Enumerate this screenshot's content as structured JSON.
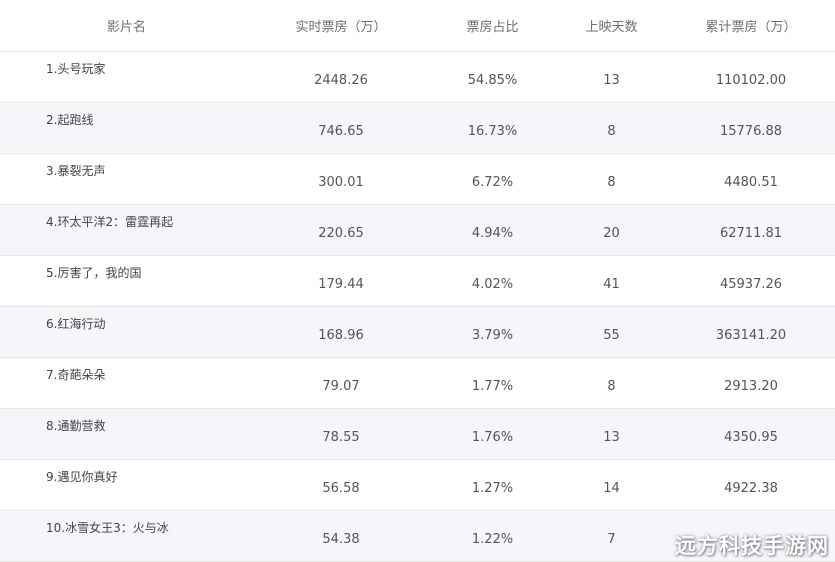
{
  "headers": [
    "影片名",
    "实时票房（万）",
    "票房占比",
    "上映天数",
    "累计票房（万）"
  ],
  "rows": [
    {
      "title": "1.头号玩家",
      "realtime": "2448.26",
      "share": "54.85%",
      "days": "13",
      "total": "110102.00"
    },
    {
      "title": "2.起跑线",
      "realtime": "746.65",
      "share": "16.73%",
      "days": "8",
      "total": "15776.88"
    },
    {
      "title": "3.暴裂无声",
      "realtime": "300.01",
      "share": "6.72%",
      "days": "8",
      "total": "4480.51"
    },
    {
      "title": "4.环太平洋2：雷霆再起",
      "realtime": "220.65",
      "share": "4.94%",
      "days": "20",
      "total": "62711.81"
    },
    {
      "title": "5.厉害了，我的国",
      "realtime": "179.44",
      "share": "4.02%",
      "days": "41",
      "total": "45937.26"
    },
    {
      "title": "6.红海行动",
      "realtime": "168.96",
      "share": "3.79%",
      "days": "55",
      "total": "363141.20"
    },
    {
      "title": "7.奇葩朵朵",
      "realtime": "79.07",
      "share": "1.77%",
      "days": "8",
      "total": "2913.20"
    },
    {
      "title": "8.通勤营救",
      "realtime": "78.55",
      "share": "1.76%",
      "days": "13",
      "total": "4350.95"
    },
    {
      "title": "9.遇见你真好",
      "realtime": "56.58",
      "share": "1.27%",
      "days": "14",
      "total": "4922.38"
    },
    {
      "title": "10.冰雪女王3：火与冰",
      "realtime": "54.38",
      "share": "1.22%",
      "days": "7",
      "total": ""
    }
  ],
  "watermark": "远方科技手游网"
}
